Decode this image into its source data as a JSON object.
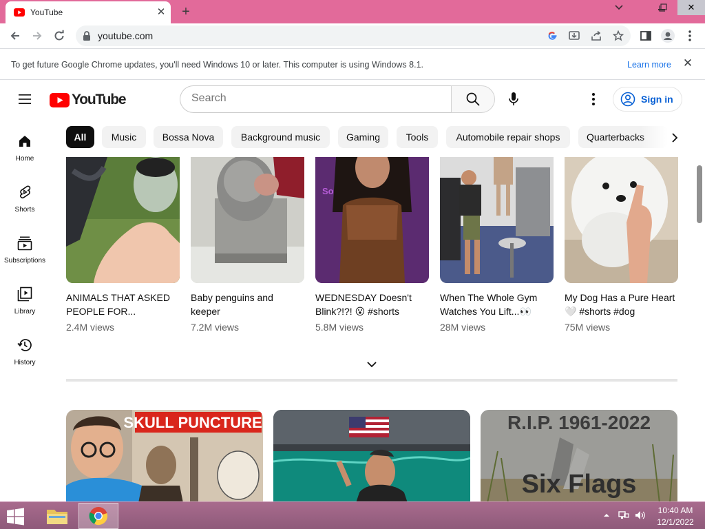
{
  "browser": {
    "tab_title": "YouTube",
    "tab_close": "✕",
    "new_tab": "+",
    "url": "youtube.com",
    "window_controls": {
      "dropdown": "⌄",
      "restore": "❐",
      "close": "✕"
    }
  },
  "infobar": {
    "message": "To get future Google Chrome updates, you'll need Windows 10 or later. This computer is using Windows 8.1.",
    "learn_more": "Learn more",
    "close": "✕"
  },
  "youtube": {
    "logo_text": "YouTube",
    "search_placeholder": "Search",
    "signin_label": "Sign in",
    "brand_red": "#ff0000",
    "link_blue": "#065fd4"
  },
  "guide": [
    {
      "label": "Home",
      "icon": "home-icon"
    },
    {
      "label": "Shorts",
      "icon": "shorts-icon"
    },
    {
      "label": "Subscriptions",
      "icon": "subscriptions-icon"
    },
    {
      "label": "Library",
      "icon": "library-icon"
    },
    {
      "label": "History",
      "icon": "history-icon"
    }
  ],
  "chips": [
    "All",
    "Music",
    "Bossa Nova",
    "Background music",
    "Gaming",
    "Tools",
    "Automobile repair shops",
    "Quarterbacks"
  ],
  "shorts": [
    {
      "title": "ANIMALS THAT ASKED PEOPLE FOR...",
      "views": "2.4M views"
    },
    {
      "title": "Baby penguins and keeper",
      "views": "7.2M views"
    },
    {
      "title": "WEDNESDAY Doesn't Blink?!?! 😮 #shorts",
      "views": "5.8M views"
    },
    {
      "title": "When The Whole Gym Watches You Lift...👀",
      "views": "28M views"
    },
    {
      "title": "My Dog Has a Pure Heart 🤍 #shorts #dog",
      "views": "75M views"
    }
  ],
  "videos": [
    {
      "overlay_text": "SKULL PUNCTURED"
    },
    {
      "overlay_text": ""
    },
    {
      "overlay_text": "R.I.P. 1961-2022",
      "overlay_text_2": "Six Flags"
    }
  ],
  "taskbar": {
    "time": "10:40 AM",
    "date": "12/1/2022"
  }
}
